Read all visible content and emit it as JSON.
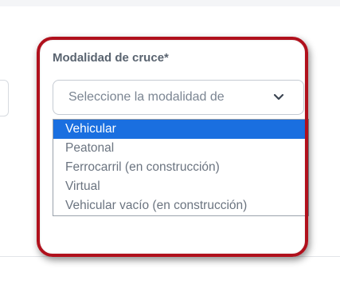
{
  "field": {
    "label": "Modalidad de cruce*",
    "placeholder": "Seleccione la modalidad de"
  },
  "dropdown": {
    "options": [
      {
        "label": "Vehicular",
        "selected": true
      },
      {
        "label": "Peatonal",
        "selected": false
      },
      {
        "label": "Ferrocarril (en construcción)",
        "selected": false
      },
      {
        "label": "Virtual",
        "selected": false
      },
      {
        "label": "Vehicular vacío (en construcción)",
        "selected": false
      }
    ]
  },
  "icons": {
    "select_arrow": "chevron-down-icon"
  },
  "colors": {
    "highlight_ring": "#b0101c",
    "selected_option_bg": "#1a6fe0",
    "selected_option_text": "#ffffff",
    "option_text": "#6b7480",
    "label_text": "#5a6470"
  }
}
